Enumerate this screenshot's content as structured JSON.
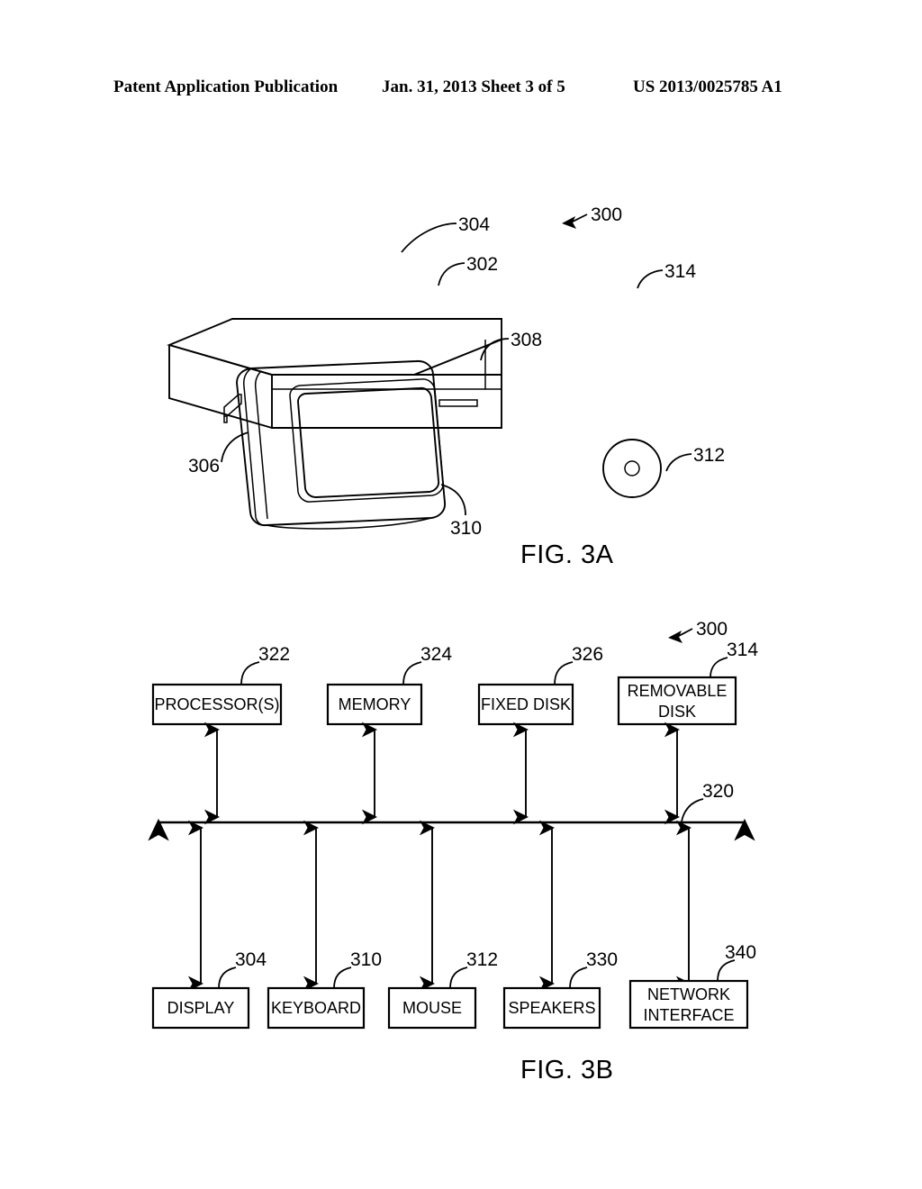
{
  "header": {
    "left": "Patent Application Publication",
    "middle": "Jan. 31, 2013  Sheet 3 of 5",
    "right": "US 2013/0025785 A1"
  },
  "fig3a": {
    "caption": "FIG. 3A",
    "refs": {
      "system": "300",
      "monitor": "302",
      "display_screen": "304",
      "base_unit": "306",
      "drive_slot": "308",
      "keyboard": "310",
      "mouse": "312",
      "removable_disk": "314"
    }
  },
  "fig3b": {
    "caption": "FIG. 3B",
    "system_ref": "300",
    "bus": {
      "label": "320"
    },
    "top_blocks": [
      {
        "label": "PROCESSOR(S)",
        "ref": "322"
      },
      {
        "label": "MEMORY",
        "ref": "324"
      },
      {
        "label": "FIXED DISK",
        "ref": "326"
      },
      {
        "label_line1": "REMOVABLE",
        "label_line2": "DISK",
        "ref": "314"
      }
    ],
    "bottom_blocks": [
      {
        "label": "DISPLAY",
        "ref": "304"
      },
      {
        "label": "KEYBOARD",
        "ref": "310"
      },
      {
        "label": "MOUSE",
        "ref": "312"
      },
      {
        "label": "SPEAKERS",
        "ref": "330"
      },
      {
        "label_line1": "NETWORK",
        "label_line2": "INTERFACE",
        "ref": "340"
      }
    ]
  },
  "colors": {
    "ink": "#000000",
    "paper": "#ffffff"
  }
}
